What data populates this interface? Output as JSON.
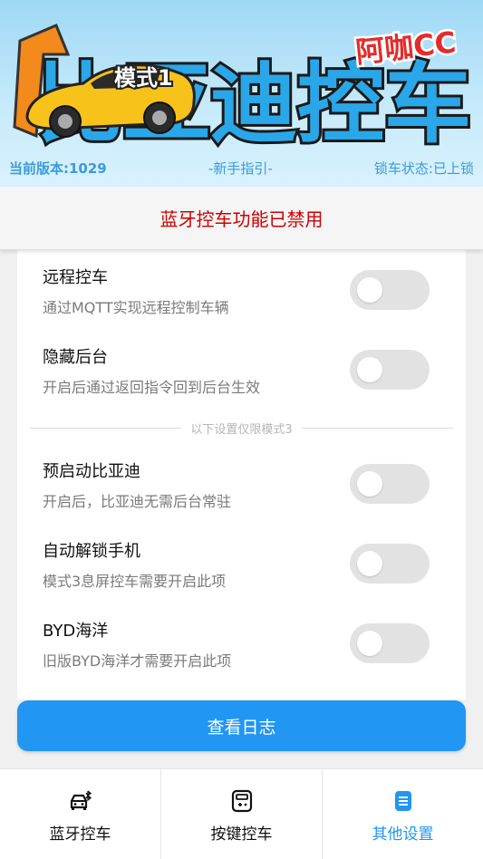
{
  "header": {
    "logo_text": "比亚迪控车",
    "logo_badge": "模式1",
    "logo_brand": "阿咖CC",
    "version": "当前版本:1029",
    "guide_link": "-新手指引-",
    "lock_status": "锁车状态:已上锁",
    "colors": {
      "info_text": "#3a9bd6",
      "logo_fill": "#2aa7e8",
      "car": "#f7c21a"
    }
  },
  "notice": {
    "text": "蓝牙控车功能已禁用",
    "color": "#cc0000"
  },
  "settings": {
    "items": [
      {
        "title": "远程控车",
        "desc": "通过MQTT实现远程控制车辆",
        "enabled": false
      },
      {
        "title": "隐藏后台",
        "desc": "开启后通过返回指令回到后台生效",
        "enabled": false
      },
      {
        "title": "预启动比亚迪",
        "desc": "开启后，比亚迪无需后台常驻",
        "enabled": false
      },
      {
        "title": "自动解锁手机",
        "desc": "模式3息屏控车需要开启此项",
        "enabled": false
      },
      {
        "title": "BYD海洋",
        "desc": "旧版BYD海洋才需要开启此项",
        "enabled": false
      }
    ],
    "divider_text": "以下设置仅限模式3"
  },
  "log_button": {
    "label": "查看日志",
    "color": "#2196f3"
  },
  "bottom_nav": {
    "items": [
      {
        "label": "蓝牙控车",
        "icon": "car-bluetooth-icon",
        "active": false
      },
      {
        "label": "按键控车",
        "icon": "remote-key-icon",
        "active": false
      },
      {
        "label": "其他设置",
        "icon": "document-icon",
        "active": true
      }
    ],
    "active_color": "#2196f3"
  }
}
